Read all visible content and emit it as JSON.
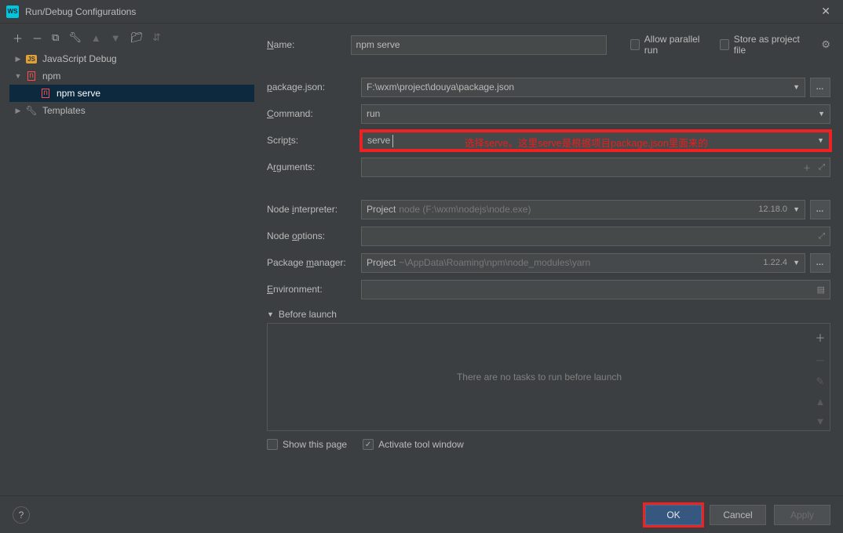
{
  "title": "Run/Debug Configurations",
  "sidebar": {
    "items": [
      {
        "label": "JavaScript Debug",
        "icon": "js"
      },
      {
        "label": "npm",
        "icon": "npm"
      },
      {
        "label": "npm serve",
        "icon": "npm",
        "selected": true
      },
      {
        "label": "Templates",
        "icon": "wrench"
      }
    ]
  },
  "form": {
    "name_label": "Name:",
    "name_value": "npm serve",
    "parallel_label": "Allow parallel run",
    "store_label": "Store as project file",
    "package_label": "package.json:",
    "package_value": "F:\\wxm\\project\\douya\\package.json",
    "command_label": "Command:",
    "command_value": "run",
    "scripts_label": "Scripts:",
    "scripts_value": "serve",
    "scripts_annotation": "选择serve。这里serve是根据项目package.json里面来的",
    "arguments_label": "Arguments:",
    "arguments_value": "",
    "node_interpreter_label": "Node interpreter:",
    "node_interpreter_prefix": "Project",
    "node_interpreter_value": "node (F:\\wxm\\nodejs\\node.exe)",
    "node_interpreter_version": "12.18.0",
    "node_options_label": "Node options:",
    "package_manager_label": "Package manager:",
    "package_manager_prefix": "Project",
    "package_manager_value": "~\\AppData\\Roaming\\npm\\node_modules\\yarn",
    "package_manager_version": "1.22.4",
    "environment_label": "Environment:"
  },
  "before_launch": {
    "header": "Before launch",
    "empty_text": "There are no tasks to run before launch"
  },
  "bottom": {
    "show_page": "Show this page",
    "activate_tool": "Activate tool window"
  },
  "footer": {
    "ok": "OK",
    "cancel": "Cancel",
    "apply": "Apply"
  }
}
